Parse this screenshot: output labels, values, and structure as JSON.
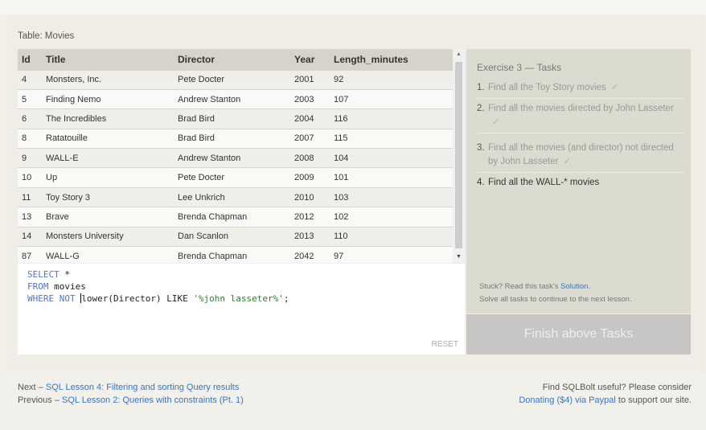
{
  "table_label": "Table: Movies",
  "columns": [
    "Id",
    "Title",
    "Director",
    "Year",
    "Length_minutes"
  ],
  "rows": [
    [
      "4",
      "Monsters, Inc.",
      "Pete Docter",
      "2001",
      "92"
    ],
    [
      "5",
      "Finding Nemo",
      "Andrew Stanton",
      "2003",
      "107"
    ],
    [
      "6",
      "The Incredibles",
      "Brad Bird",
      "2004",
      "116"
    ],
    [
      "8",
      "Ratatouille",
      "Brad Bird",
      "2007",
      "115"
    ],
    [
      "9",
      "WALL-E",
      "Andrew Stanton",
      "2008",
      "104"
    ],
    [
      "10",
      "Up",
      "Pete Docter",
      "2009",
      "101"
    ],
    [
      "11",
      "Toy Story 3",
      "Lee Unkrich",
      "2010",
      "103"
    ],
    [
      "13",
      "Brave",
      "Brenda Chapman",
      "2012",
      "102"
    ],
    [
      "14",
      "Monsters University",
      "Dan Scanlon",
      "2013",
      "110"
    ],
    [
      "87",
      "WALL-G",
      "Brenda Chapman",
      "2042",
      "97"
    ]
  ],
  "scroll_icons": {
    "up": "triangle-up",
    "down": "triangle-down"
  },
  "editor": {
    "line1_kw": "SELECT",
    "line1_rest": " *",
    "line2_kw": "FROM",
    "line2_rest": " movies",
    "line3_kw": "WHERE NOT",
    "line3_plain": "lower(Director) LIKE ",
    "line3_str": "'%john lasseter%'",
    "line3_end": ";",
    "reset_label": "RESET"
  },
  "tasks": {
    "title": "Exercise 3 — Tasks",
    "items": [
      {
        "num": "1.",
        "text": "Find all the Toy Story movies",
        "check": "✓"
      },
      {
        "num": "2.",
        "text": "Find all the movies directed by John Lasseter",
        "check": "✓"
      },
      {
        "num": "3.",
        "text": "Find all the movies (and director) not directed by John Lasseter",
        "check": "✓"
      },
      {
        "num": "4.",
        "text": "Find all the WALL-* movies"
      }
    ],
    "stuck_prefix": "Stuck? Read this task's ",
    "stuck_link": "Solution",
    "stuck_suffix": ".",
    "solve_text": "Solve all tasks to continue to the next lesson.",
    "finish_label": "Finish above Tasks"
  },
  "footer": {
    "next_prefix": "Next – ",
    "next_link": "SQL Lesson 4: Filtering and sorting Query results",
    "prev_prefix": "Previous – ",
    "prev_link": "SQL Lesson 2: Queries with constraints (Pt. 1)",
    "useful_text": "Find SQLBolt useful? Please consider",
    "donate_link": "Donating ($4) via Paypal",
    "donate_suffix": " to support our site."
  },
  "colors": {
    "link": "#3a73c4",
    "check": "#8fc88f",
    "keyword": "#5577bb",
    "string": "#2e7d32"
  }
}
